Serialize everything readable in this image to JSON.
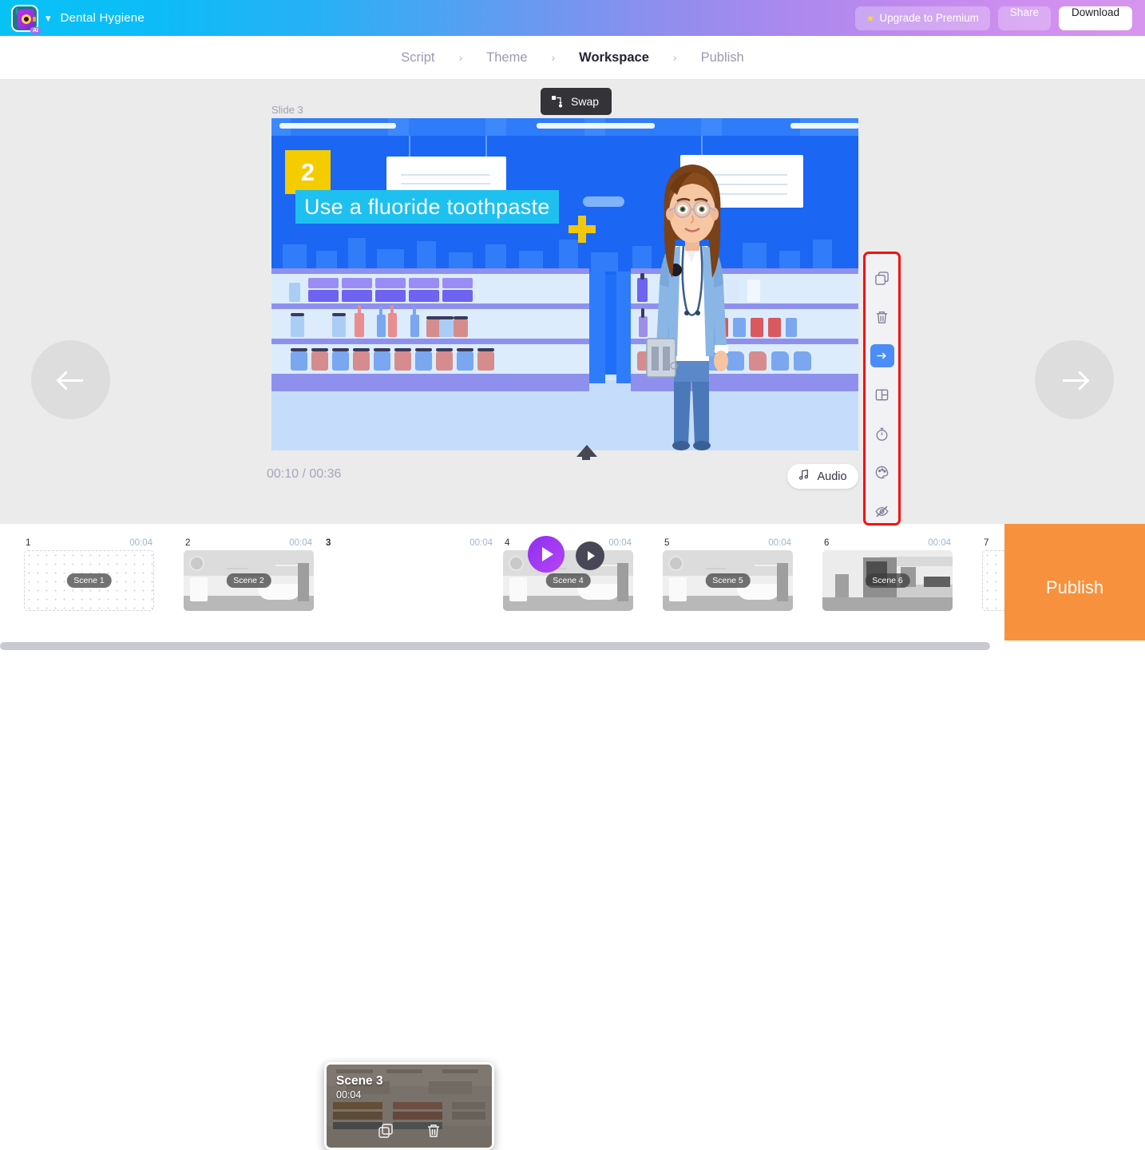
{
  "header": {
    "logo_icon": "ai-camera-logo",
    "logo_badge": "AI",
    "dropdown_icon": "chevron-down-icon",
    "project_title": "Dental Hygiene",
    "upgrade_label": "Upgrade to Premium",
    "upgrade_star_icon": "star-icon",
    "share_label": "Share",
    "download_label": "Download",
    "gradient_start": "#09c2f5",
    "gradient_end": "#d795ef"
  },
  "breadcrumb": {
    "separator": "›",
    "steps": [
      {
        "label": "Script",
        "active": false
      },
      {
        "label": "Theme",
        "active": false
      },
      {
        "label": "Workspace",
        "active": true
      },
      {
        "label": "Publish",
        "active": false
      }
    ]
  },
  "stage": {
    "slide_label": "Slide 3",
    "swap_label": "Swap",
    "swap_icon": "swap-icon",
    "prev_icon": "arrow-left-icon",
    "next_icon": "arrow-right-icon"
  },
  "canvas": {
    "number_badge": "2",
    "caption_text": "Use a fluoride toothpaste",
    "badge_color": "#f5cc00",
    "caption_bg": "#1ec0f0",
    "scene_description": "pharmacy-store-shelves-with-pharmacist",
    "plus_icon": "plus-marker-icon"
  },
  "toolbar": {
    "highlight_color": "#f5110f",
    "items": [
      {
        "name": "duplicate-icon",
        "active": false
      },
      {
        "name": "delete-icon",
        "active": false
      },
      {
        "name": "transition-arrow-icon",
        "active": true
      },
      {
        "name": "layout-icon",
        "active": false
      },
      {
        "name": "timer-icon",
        "active": false
      },
      {
        "name": "palette-icon",
        "active": false
      },
      {
        "name": "hide-eye-icon",
        "active": false
      }
    ]
  },
  "playback": {
    "current_time": "00:10",
    "total_time": "00:36",
    "time_display": "00:10 / 00:36",
    "play_icon": "play-icon",
    "preview_play_icon": "play-icon",
    "caret_icon": "caret-up-icon",
    "audio_label": "Audio",
    "audio_icon": "music-note-icon"
  },
  "timeline": {
    "scenes": [
      {
        "index": "1",
        "duration": "00:04",
        "label": "Scene 1",
        "art": "empty",
        "selected": false
      },
      {
        "index": "2",
        "duration": "00:04",
        "label": "Scene 2",
        "art": "bathroom",
        "selected": false
      },
      {
        "index": "3",
        "duration": "00:04",
        "label": "Scene 3",
        "art": "store",
        "selected": true
      },
      {
        "index": "4",
        "duration": "00:04",
        "label": "Scene 4",
        "art": "bathroom",
        "selected": false
      },
      {
        "index": "5",
        "duration": "00:04",
        "label": "Scene 5",
        "art": "bathroom",
        "selected": false
      },
      {
        "index": "6",
        "duration": "00:04",
        "label": "Scene 6",
        "art": "kitchen",
        "selected": false
      },
      {
        "index": "7",
        "duration": "",
        "label": "",
        "art": "empty",
        "selected": false
      }
    ],
    "selected_scene": {
      "title": "Scene 3",
      "duration": "00:04",
      "duplicate_icon": "duplicate-icon",
      "delete_icon": "delete-icon"
    },
    "publish_label": "Publish",
    "publish_color": "#f7913d"
  }
}
